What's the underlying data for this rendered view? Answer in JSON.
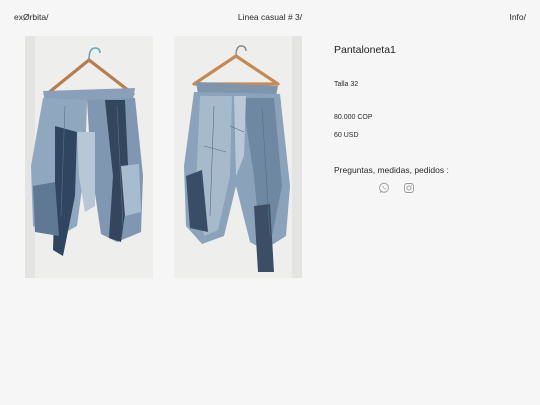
{
  "header": {
    "brand": "exØrbita/",
    "collection": "Linea casual # 3/",
    "info": "Info/"
  },
  "product": {
    "title": "Pantaloneta1",
    "size": "Talla 32",
    "price_cop": "80.000 COP",
    "price_usd": "60 USD",
    "contact_label": "Preguntas, medidas, pedidos :"
  },
  "gallery": {
    "images": [
      "front-view-photo",
      "back-view-photo"
    ]
  },
  "social": {
    "icons": [
      "whatsapp-icon",
      "instagram-icon"
    ],
    "icon_color": "#9a9a9a"
  },
  "colors": {
    "background": "#f6f6f6",
    "text": "#2a2a2a",
    "denim_light": "#9fb2c4",
    "denim_dark": "#2f4058"
  }
}
